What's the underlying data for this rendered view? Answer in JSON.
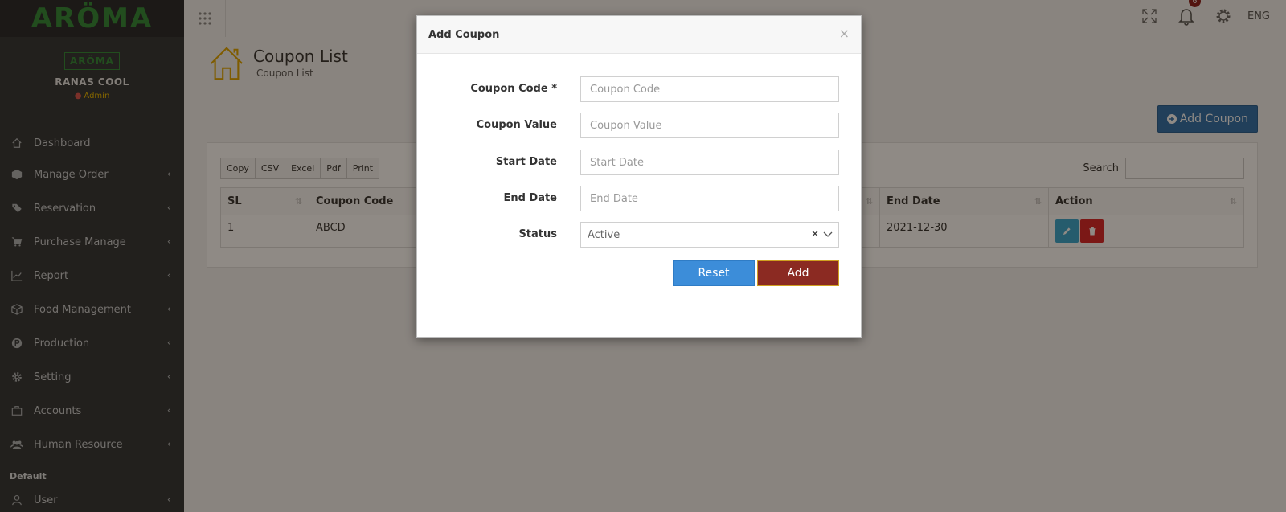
{
  "brand": {
    "name": "ARÖMA",
    "profile_logo": "ARÖMA"
  },
  "user": {
    "name": "RANAS COOL",
    "role": "Admin"
  },
  "sidebar": {
    "items": [
      {
        "label": "Dashboard",
        "icon": "home-icon"
      },
      {
        "label": "Manage Order",
        "icon": "box-icon"
      },
      {
        "label": "Reservation",
        "icon": "tag-icon"
      },
      {
        "label": "Purchase Manage",
        "icon": "cart-icon"
      },
      {
        "label": "Report",
        "icon": "chart-icon"
      },
      {
        "label": "Food Management",
        "icon": "cube-icon"
      },
      {
        "label": "Production",
        "icon": "product-hunt-icon"
      },
      {
        "label": "Setting",
        "icon": "gear-icon"
      },
      {
        "label": "Accounts",
        "icon": "briefcase-icon"
      },
      {
        "label": "Human Resource",
        "icon": "users-icon"
      }
    ],
    "section_default": "Default",
    "user_item": "User"
  },
  "topbar": {
    "notification_count": "6",
    "language": "ENG"
  },
  "page": {
    "title": "Coupon List",
    "subtitle": "Coupon List",
    "add_button": "Add Coupon"
  },
  "table": {
    "buttons": [
      "Copy",
      "CSV",
      "Excel",
      "Pdf",
      "Print"
    ],
    "search_label": "Search",
    "headers": {
      "sl": "SL",
      "coupon_code": "Coupon Code",
      "end_date": "End Date",
      "action": "Action"
    },
    "rows": [
      {
        "sl": "1",
        "coupon_code": "ABCD",
        "end_date": "2021-12-30"
      }
    ]
  },
  "modal": {
    "title": "Add Coupon",
    "close": "×",
    "fields": {
      "coupon_code": {
        "label": "Coupon Code *",
        "placeholder": "Coupon Code",
        "value": ""
      },
      "coupon_value": {
        "label": "Coupon Value",
        "placeholder": "Coupon Value",
        "value": ""
      },
      "start_date": {
        "label": "Start Date",
        "placeholder": "Start Date",
        "value": ""
      },
      "end_date": {
        "label": "End Date",
        "placeholder": "End Date",
        "value": ""
      },
      "status": {
        "label": "Status",
        "value": "Active"
      }
    },
    "reset_label": "Reset",
    "add_label": "Add"
  },
  "colors": {
    "sidebar_bg": "#2f3438",
    "brand_green": "#2e8b3a",
    "primary_blue": "#2c6fad",
    "reset_blue": "#3c8dd9",
    "add_maroon": "#8b2a22",
    "edit_cyan": "#37a8d1",
    "delete_red": "#d9252b"
  }
}
